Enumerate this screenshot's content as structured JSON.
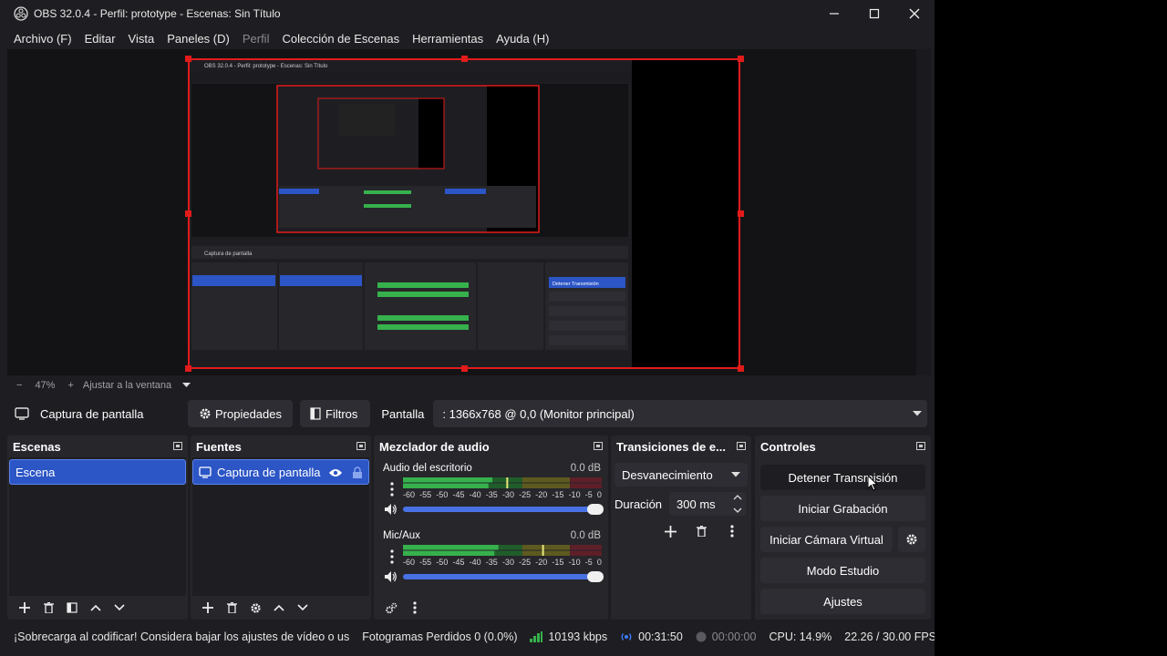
{
  "window": {
    "title": "OBS 32.0.4 - Perfil: prototype - Escenas: Sin Título"
  },
  "menu": [
    "Archivo (F)",
    "Editar",
    "Vista",
    "Paneles (D)",
    "Perfil",
    "Colección de Escenas",
    "Herramientas",
    "Ayuda (H)"
  ],
  "zoom": {
    "percent": "47%",
    "fit_label": "Ajustar a la ventana"
  },
  "source_toolbar": {
    "source_name": "Captura de pantalla",
    "properties_label": "Propiedades",
    "filters_label": "Filtros",
    "screen_label": "Pantalla",
    "screen_value": ": 1366x768 @ 0,0 (Monitor principal)"
  },
  "docks": {
    "scenes": {
      "title": "Escenas",
      "items": [
        "Escena"
      ]
    },
    "sources": {
      "title": "Fuentes",
      "items": [
        "Captura de pantalla"
      ]
    },
    "mixer": {
      "title": "Mezclador de audio",
      "scale": [
        "-60",
        "-55",
        "-50",
        "-45",
        "-40",
        "-35",
        "-30",
        "-25",
        "-20",
        "-15",
        "-10",
        "-5",
        "0"
      ],
      "channels": [
        {
          "name": "Audio del escritorio",
          "db": "0.0 dB",
          "level": 0.45,
          "peak": 0.52,
          "volume": 1.0
        },
        {
          "name": "Mic/Aux",
          "db": "0.0 dB",
          "level": 0.48,
          "peak": 0.7,
          "volume": 1.0
        }
      ]
    },
    "transitions": {
      "title": "Transiciones de e...",
      "selected": "Desvanecimiento",
      "duration_label": "Duración",
      "duration_value": "300 ms"
    },
    "controls": {
      "title": "Controles",
      "stop_stream": "Detener Transmisión",
      "start_recording": "Iniciar Grabación",
      "start_virtualcam": "Iniciar Cámara Virtual",
      "studio_mode": "Modo Estudio",
      "settings": "Ajustes"
    }
  },
  "status": {
    "warning": "¡Sobrecarga al codificar! Considera bajar los ajustes de vídeo o us",
    "dropped": "Fotogramas Perdidos 0 (0.0%)",
    "bitrate": "10193 kbps",
    "stream_time": "00:31:50",
    "rec_time": "00:00:00",
    "cpu": "CPU: 14.9%",
    "fps": "22.26 / 30.00 FPS"
  },
  "colors": {
    "accent": "#2c55c6",
    "selection_red": "#e21b1b",
    "live": "#3b7bff"
  }
}
